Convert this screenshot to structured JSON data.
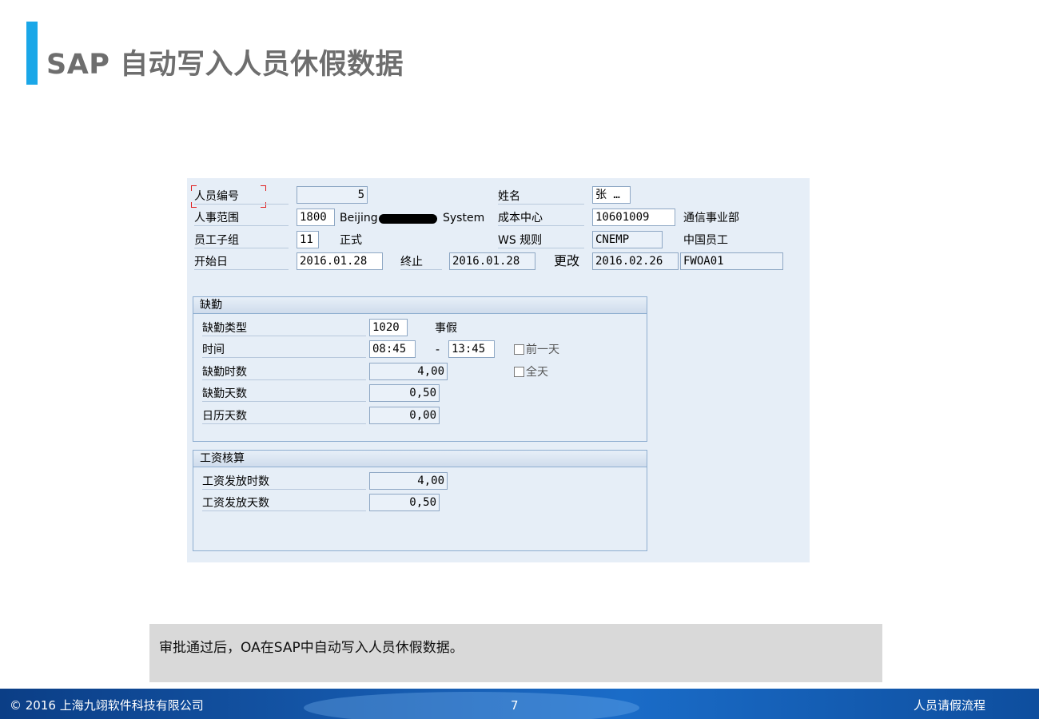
{
  "slide": {
    "title": "SAP 自动写入人员休假数据",
    "note": "审批通过后，OA在SAP中自动写入人员休假数据。"
  },
  "header": {
    "personnel_no_label": "人员编号",
    "personnel_no": "5",
    "name_label": "姓名",
    "name": "张 …",
    "personnel_area_label": "人事范围",
    "personnel_area_code": "1800",
    "personnel_area_text_1": "Beijing",
    "personnel_area_text_2": "System",
    "cost_center_label": "成本中心",
    "cost_center": "10601009",
    "cost_center_text": "通信事业部",
    "subgroup_label": "员工子组",
    "subgroup_code": "11",
    "subgroup_text": "正式",
    "ws_rule_label": "WS 规则",
    "ws_rule": "CNEMP",
    "ws_rule_text": "中国员工",
    "start_label": "开始日",
    "start_date": "2016.01.28",
    "end_label": "终止",
    "end_date": "2016.01.28",
    "changed_label": "更改",
    "changed_date": "2016.02.26",
    "changed_by": "FWOA01"
  },
  "absence": {
    "group_title": "缺勤",
    "type_label": "缺勤类型",
    "type_code": "1020",
    "type_text": "事假",
    "time_label": "时间",
    "time_from": "08:45",
    "time_dash": "-",
    "time_to": "13:45",
    "prev_day_label": "前一天",
    "full_day_label": "全天",
    "hours_label": "缺勤时数",
    "hours": "4,00",
    "days_label": "缺勤天数",
    "days": "0,50",
    "calendar_days_label": "日历天数",
    "calendar_days": "0,00"
  },
  "payroll": {
    "group_title": "工资核算",
    "hours_label": "工资发放时数",
    "hours": "4,00",
    "days_label": "工资发放天数",
    "days": "0,50"
  },
  "footer": {
    "copyright": "© 2016 上海九翊软件科技有限公司",
    "page_number": "7",
    "section": "人员请假流程"
  },
  "colors": {
    "accent": "#1aa7e8",
    "sap_background": "#e6eef7",
    "footer_blue": "#1860b6"
  }
}
